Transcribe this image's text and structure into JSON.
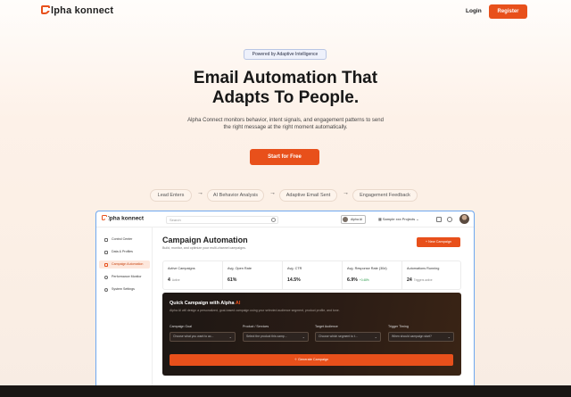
{
  "nav": {
    "brand": "lpha konnect",
    "login": "Login",
    "register": "Register"
  },
  "hero": {
    "badge": "Powered by Adaptive Intelligence",
    "title_line1": "Email Automation That",
    "title_line2": "Adapts To People.",
    "sub_line1": "Alpha Connect monitors behavior, intent signals, and engagement patterns to send",
    "sub_line2": "the right message at the right moment automatically.",
    "cta": "Start for Free"
  },
  "flow": [
    "Lead Enters",
    "AI Behavior Analysis",
    "Adaptive Email Sent",
    "Engagement Feedback"
  ],
  "app": {
    "brand": "lpha konnect",
    "search_placeholder": "Search",
    "badge": "Alpha AI",
    "project": "Sample xxx Projects",
    "sidebar": [
      "Control Center",
      "Data & Profiles",
      "Campaign Automation",
      "Performance Monitor",
      "System Settings"
    ],
    "page_title": "Campaign Automation",
    "page_sub": "Build, monitor, and optimize your multi-channel campaigns.",
    "new_button": "+ New Campaign",
    "stats": [
      {
        "label": "Active Campaigns",
        "value": "4",
        "note": "Active"
      },
      {
        "label": "Avg. Open Rate",
        "value": "61%",
        "note": ""
      },
      {
        "label": "Avg. CTR",
        "value": "14.5%",
        "note": ""
      },
      {
        "label": "Avg. Response Rate (30d)",
        "value": "6.9%",
        "good": "+0.48%"
      },
      {
        "label": "Automations Running",
        "value": "24",
        "note": "Triggers active"
      }
    ],
    "quick": {
      "title": "Quick Campaign with Alpha ",
      "title_hl": "AI",
      "sub": "Alpha AI will design a personalized, goal-based campaign using your selected audience segment, product profile, and tone.",
      "fields": [
        {
          "label": "Campaign Goal",
          "placeholder": "Choose what you want to ac..."
        },
        {
          "label": "Product / Services",
          "placeholder": "Select the product this camp..."
        },
        {
          "label": "Target Audience",
          "placeholder": "Choose which segment to t..."
        },
        {
          "label": "Trigger Timing",
          "placeholder": "When should campaign start?"
        }
      ],
      "generate": "Generate Campaign"
    }
  }
}
